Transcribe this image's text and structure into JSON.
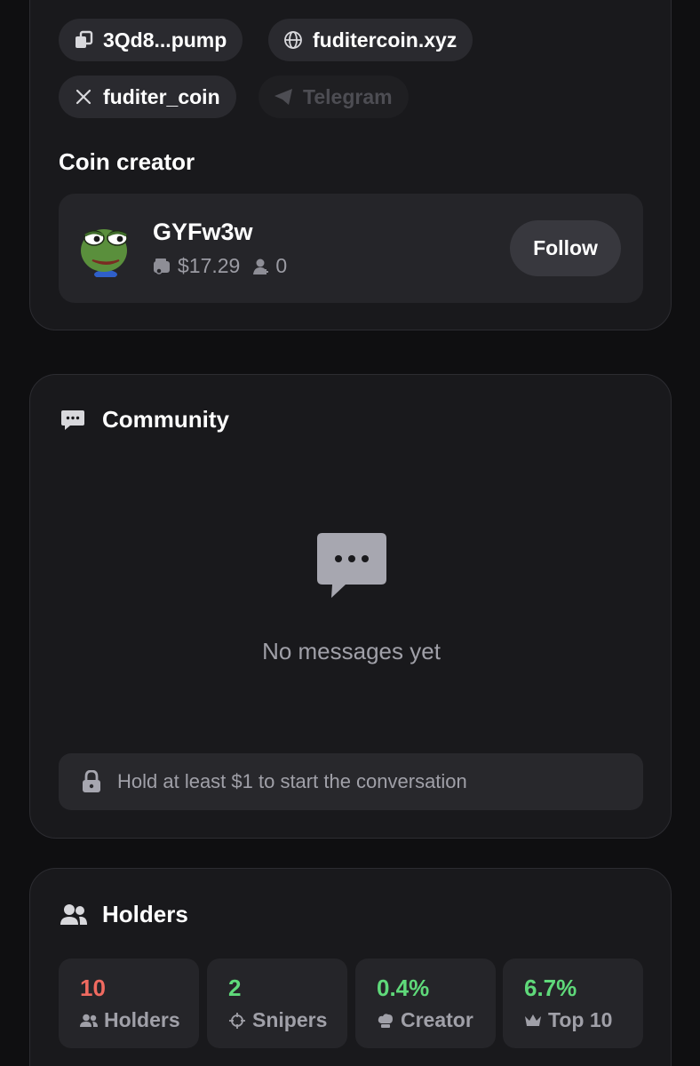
{
  "links": {
    "contract": "3Qd8...pump",
    "website": "fuditercoin.xyz",
    "twitter": "fuditer_coin",
    "telegram": "Telegram"
  },
  "creator": {
    "section_title": "Coin creator",
    "name": "GYFw3w",
    "balance": "$17.29",
    "followers": "0",
    "follow_label": "Follow"
  },
  "community": {
    "title": "Community",
    "empty_text": "No messages yet",
    "hold_notice": "Hold at least $1 to start the conversation"
  },
  "holders": {
    "title": "Holders",
    "stats": [
      {
        "value": "10",
        "label": "Holders",
        "color": "#f06a60",
        "icon": "users-icon"
      },
      {
        "value": "2",
        "label": "Snipers",
        "color": "#5fd97a",
        "icon": "crosshair-icon"
      },
      {
        "value": "0.4%",
        "label": "Creator",
        "color": "#5fd97a",
        "icon": "chef-hat-icon"
      },
      {
        "value": "6.7%",
        "label": "Top 10",
        "color": "#5fd97a",
        "icon": "crown-icon"
      }
    ]
  }
}
